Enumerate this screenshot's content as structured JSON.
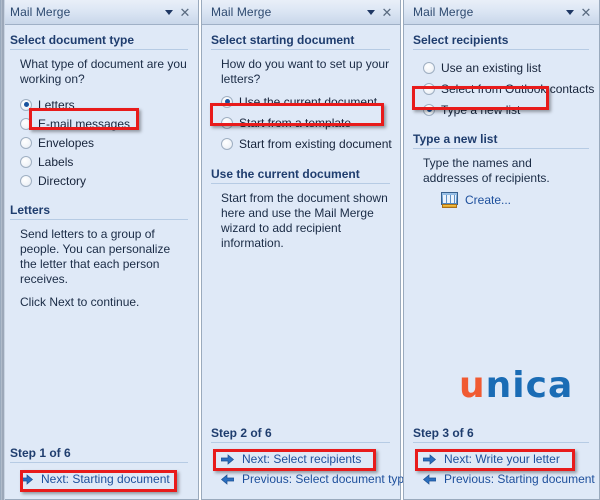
{
  "window": {
    "title": "Mail Merge",
    "dropdown_icon": "chevron-down-icon",
    "close_icon": "close-icon"
  },
  "panels": [
    {
      "id": "step1",
      "title": "Mail Merge",
      "section_heading": "Select document type",
      "question": "What type of document are you working on?",
      "options": [
        {
          "label": "Letters",
          "selected": true,
          "highlighted": true
        },
        {
          "label": "E-mail messages",
          "selected": false,
          "highlighted": false
        },
        {
          "label": "Envelopes",
          "selected": false,
          "highlighted": false
        },
        {
          "label": "Labels",
          "selected": false,
          "highlighted": false
        },
        {
          "label": "Directory",
          "selected": false,
          "highlighted": false
        }
      ],
      "detail_heading": "Letters",
      "detail_text_1": "Send letters to a group of people. You can personalize the letter that each person receives.",
      "detail_text_2": "Click Next to continue.",
      "step_label": "Step 1 of 6",
      "next_label": "Next: Starting document",
      "prev_label": ""
    },
    {
      "id": "step2",
      "title": "Mail Merge",
      "section_heading": "Select starting document",
      "question": "How do you want to set up your letters?",
      "options": [
        {
          "label": "Use the current document",
          "selected": true,
          "highlighted": true
        },
        {
          "label": "Start from a template",
          "selected": false,
          "highlighted": false
        },
        {
          "label": "Start from existing document",
          "selected": false,
          "highlighted": false
        }
      ],
      "detail_heading": "Use the current document",
      "detail_text_1": "Start from the document shown here and use the Mail Merge wizard to add recipient information.",
      "detail_text_2": "",
      "step_label": "Step 2 of 6",
      "next_label": "Next: Select recipients",
      "prev_label": "Previous: Select document type"
    },
    {
      "id": "step3",
      "title": "Mail Merge",
      "section_heading": "Select recipients",
      "question": "",
      "options": [
        {
          "label": "Use an existing list",
          "selected": false,
          "highlighted": false
        },
        {
          "label": "Select from Outlook contacts",
          "selected": false,
          "highlighted": false
        },
        {
          "label": "Type a new list",
          "selected": true,
          "highlighted": true
        }
      ],
      "detail_heading": "Type a new list",
      "detail_text_1": "Type the names and addresses of recipients.",
      "detail_text_2": "",
      "create_link": "Create...",
      "create_icon": "spreadsheet-icon",
      "step_label": "Step 3 of 6",
      "next_label": "Next: Write your letter",
      "prev_label": "Previous: Starting document"
    }
  ],
  "logo": {
    "part_1": "u",
    "part_2": "nica",
    "color_1": "#f05a32",
    "color_2": "#1a6cb5"
  },
  "colors": {
    "pane_background": "#dfe9f7",
    "heading": "#1f3d6e",
    "link": "#1d4f9c",
    "highlight_border": "#e81b1b",
    "radio_dot": "#18539e"
  }
}
